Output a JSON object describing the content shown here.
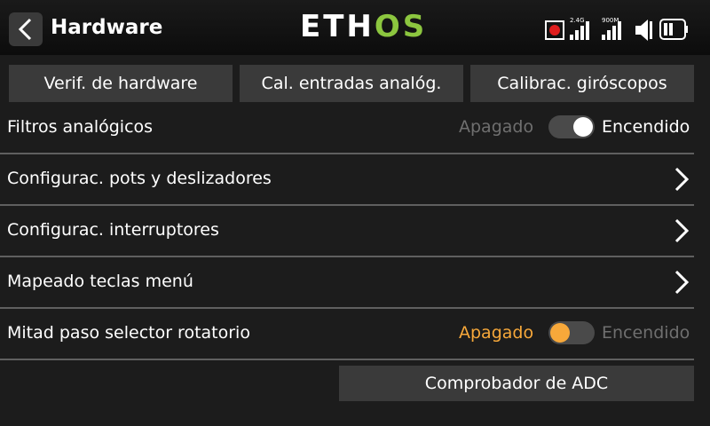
{
  "header": {
    "title": "Hardware",
    "logo_left": "ETH",
    "logo_right": "OS",
    "status": {
      "rf_24_label": "2.4G",
      "rf_900_label": "900M"
    }
  },
  "buttons": {
    "hw_check": "Verif. de hardware",
    "analog_cal": "Cal. entradas analóg.",
    "gyro_cal": "Calibrac. giróscopos"
  },
  "rows": {
    "analog_filters": {
      "label": "Filtros analógicos",
      "off_label": "Apagado",
      "on_label": "Encendido",
      "state": "on"
    },
    "pots_sliders": {
      "label": "Configurac. pots y deslizadores"
    },
    "switches": {
      "label": "Configurac. interruptores"
    },
    "menu_keys": {
      "label": "Mapeado teclas menú"
    },
    "rotary_half_step": {
      "label": "Mitad paso selector rotatorio",
      "off_label": "Apagado",
      "on_label": "Encendido",
      "state": "off"
    }
  },
  "adc_button": "Comprobador de ADC",
  "colors": {
    "accent": "#f7a83a",
    "logo_green": "#8cc63f",
    "record_red": "#e01e1e",
    "dim_text": "#6f6f6f"
  }
}
